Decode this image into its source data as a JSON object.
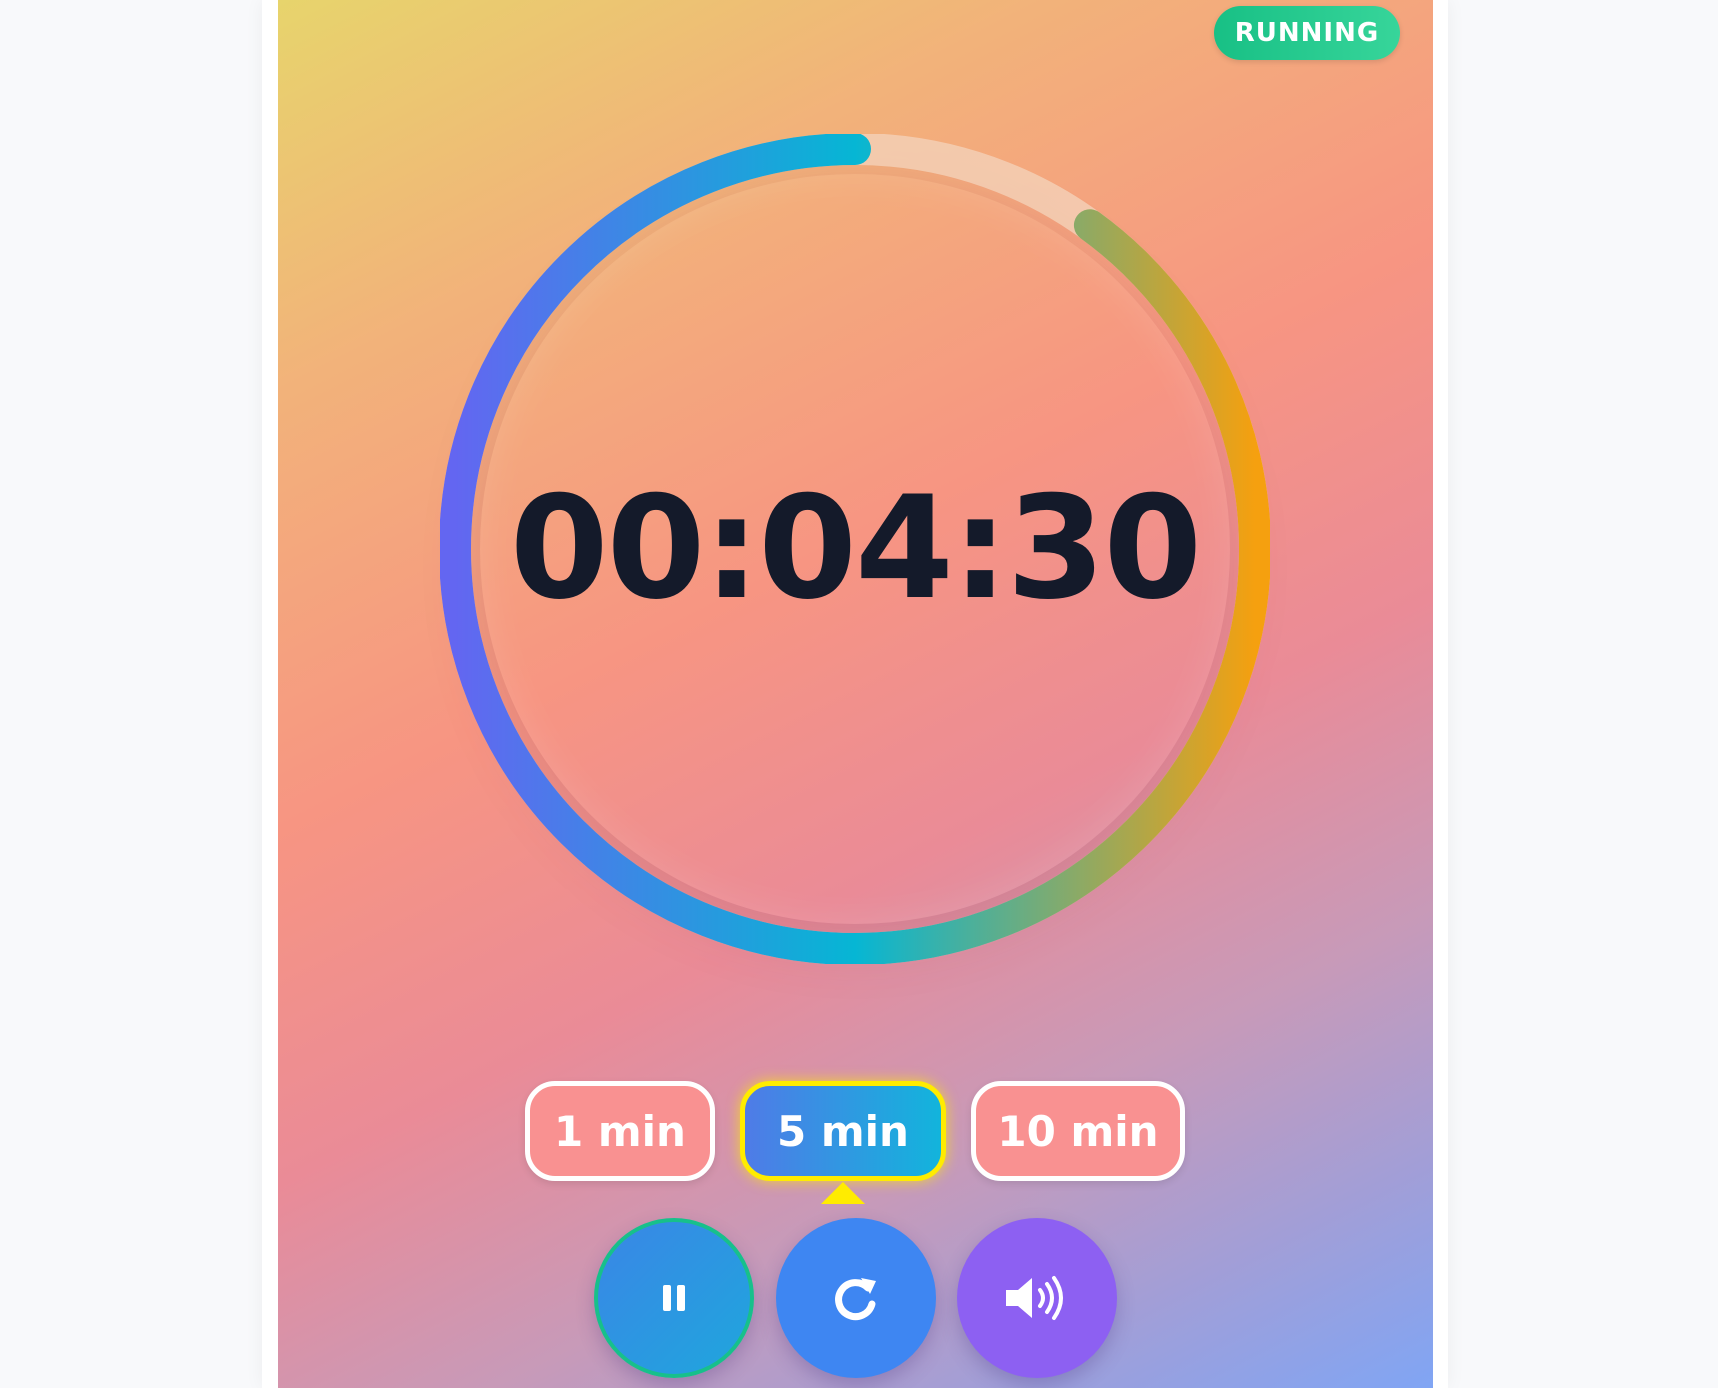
{
  "status": {
    "label": "RUNNING",
    "color": "#1fc88a"
  },
  "timer": {
    "display": "00:04:30",
    "progress_fraction": 0.9
  },
  "presets": [
    {
      "label": "1 min",
      "selected": false
    },
    {
      "label": "5 min",
      "selected": true
    },
    {
      "label": "10 min",
      "selected": false
    }
  ],
  "controls": {
    "pause": {
      "icon": "pause-icon"
    },
    "reset": {
      "icon": "refresh-icon"
    },
    "sound": {
      "icon": "volume-icon"
    }
  },
  "colors": {
    "ring_track": "#f3cfb5",
    "ring_start": "#f5a00f",
    "ring_mid": "#06b6d4",
    "ring_end": "#6366f1",
    "selected_outline": "#ffec00"
  }
}
